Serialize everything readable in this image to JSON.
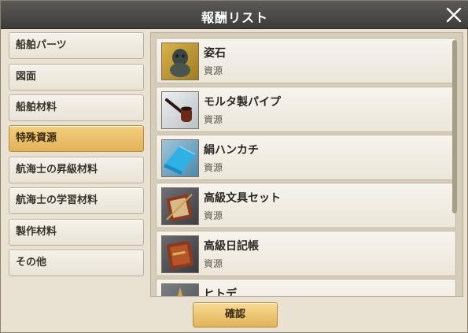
{
  "dialog": {
    "title": "報酬リスト",
    "close_icon": "close-icon",
    "confirm_label": "確認"
  },
  "categories": [
    {
      "label": "船舶パーツ",
      "active": false
    },
    {
      "label": "図面",
      "active": false
    },
    {
      "label": "船舶材料",
      "active": false
    },
    {
      "label": "特殊資源",
      "active": true
    },
    {
      "label": "航海士の昇級材料",
      "active": false
    },
    {
      "label": "航海士の学習材料",
      "active": false
    },
    {
      "label": "製作材料",
      "active": false
    },
    {
      "label": "その他",
      "active": false
    }
  ],
  "items": [
    {
      "name": "姿石",
      "type": "資源",
      "icon": "stone-figure-icon"
    },
    {
      "name": "モルタ製パイプ",
      "type": "資源",
      "icon": "pipe-icon"
    },
    {
      "name": "絹ハンカチ",
      "type": "資源",
      "icon": "handkerchief-icon"
    },
    {
      "name": "高級文具セット",
      "type": "資源",
      "icon": "stationery-set-icon"
    },
    {
      "name": "高級日記帳",
      "type": "資源",
      "icon": "diary-icon"
    },
    {
      "name": "ヒトデ",
      "type": "",
      "icon": "starfish-icon"
    }
  ]
}
